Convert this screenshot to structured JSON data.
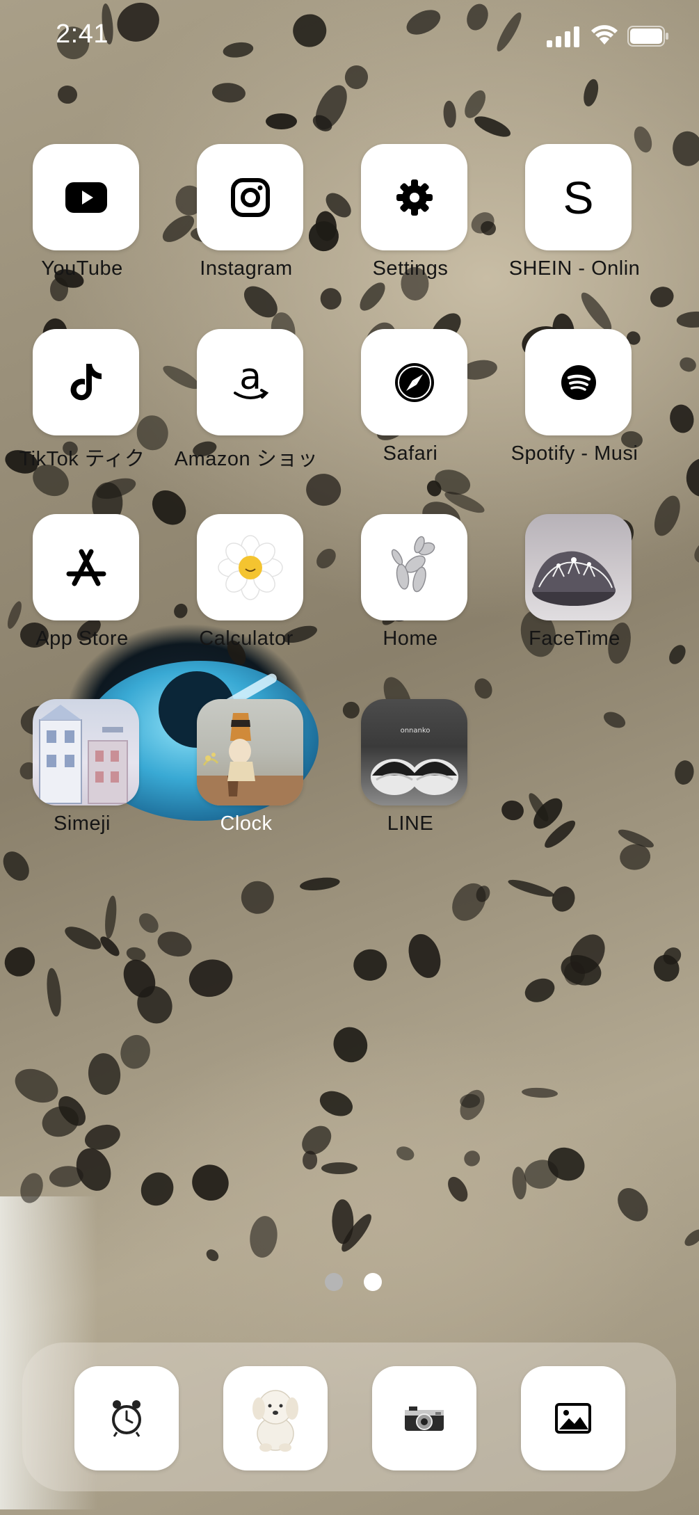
{
  "status_bar": {
    "time": "2:41",
    "signal_icon": "cellular-signal-icon",
    "wifi_icon": "wifi-icon",
    "battery_icon": "battery-icon"
  },
  "apps": [
    {
      "label": "YouTube",
      "icon": "youtube-icon"
    },
    {
      "label": "Instagram",
      "icon": "instagram-icon"
    },
    {
      "label": "Settings",
      "icon": "gear-icon"
    },
    {
      "label": "SHEIN - Onlin",
      "icon": "shein-icon"
    },
    {
      "label": "TikTok ティク",
      "icon": "tiktok-icon"
    },
    {
      "label": "Amazon ショッ",
      "icon": "amazon-icon"
    },
    {
      "label": "Safari",
      "icon": "compass-icon"
    },
    {
      "label": "Spotify - Musi",
      "icon": "spotify-icon"
    },
    {
      "label": "App Store",
      "icon": "app-store-icon"
    },
    {
      "label": "Calculator",
      "icon": "daisy-photo-icon"
    },
    {
      "label": "Home",
      "icon": "balloon-dog-photo-icon"
    },
    {
      "label": "FaceTime",
      "icon": "tiara-photo-icon"
    },
    {
      "label": "Simeji",
      "icon": "building-photo-icon"
    },
    {
      "label": "Clock",
      "icon": "figure-photo-icon"
    },
    {
      "label": "LINE",
      "icon": "twins-photo-icon",
      "photo_text": "onnanko"
    }
  ],
  "page_dots": {
    "count": 2,
    "active_index": 1
  },
  "dock": [
    {
      "name": "clock",
      "icon": "alarm-clock-icon"
    },
    {
      "name": "plush",
      "icon": "teddy-dog-icon"
    },
    {
      "name": "camera",
      "icon": "camera-icon"
    },
    {
      "name": "photos",
      "icon": "photo-icon"
    }
  ],
  "colors": {
    "tile": "#ffffff",
    "label": "#151515",
    "dot_active": "#ffffff",
    "dot_inactive": "#b5b5b5"
  }
}
